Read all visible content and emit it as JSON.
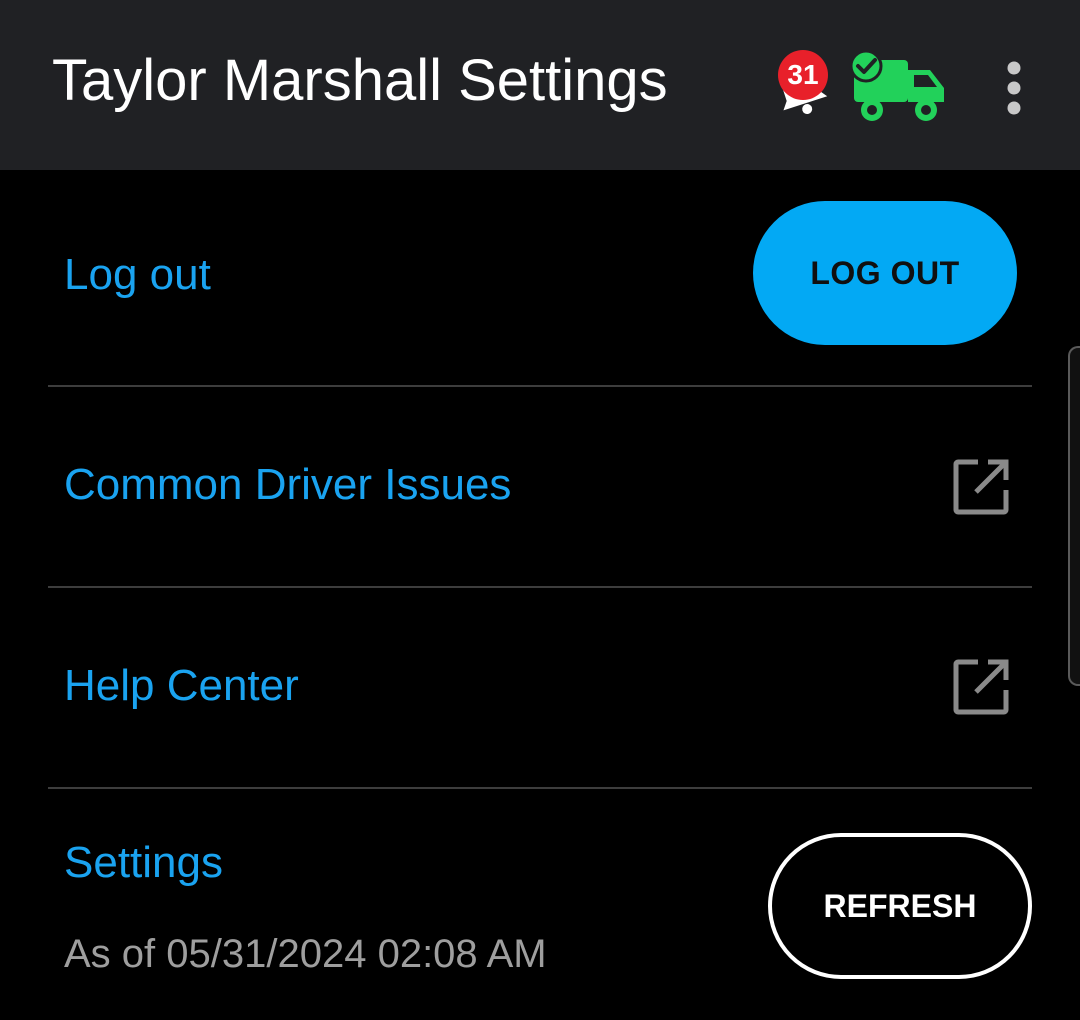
{
  "app_bar": {
    "title": "Taylor Marshall Settings",
    "notification_count": "31",
    "colors": {
      "badge": "#e8202a",
      "truck": "#22d15a"
    },
    "icons": [
      "bell-icon",
      "delivery-truck-check-icon",
      "more-vert-icon"
    ]
  },
  "rows": {
    "logout": {
      "label": "Log out",
      "button_label": "LOG OUT"
    },
    "common_issues": {
      "label": "Common Driver Issues",
      "icon": "open-in-new-icon"
    },
    "help_center": {
      "label": "Help Center",
      "icon": "open-in-new-icon"
    },
    "settings": {
      "label": "Settings",
      "as_of": "As of 05/31/2024 02:08 AM",
      "button_label": "REFRESH"
    }
  },
  "colors": {
    "accent": "#1aa3f0",
    "button_fill": "#03a9f4",
    "background": "#000000",
    "app_bar": "#202124"
  }
}
